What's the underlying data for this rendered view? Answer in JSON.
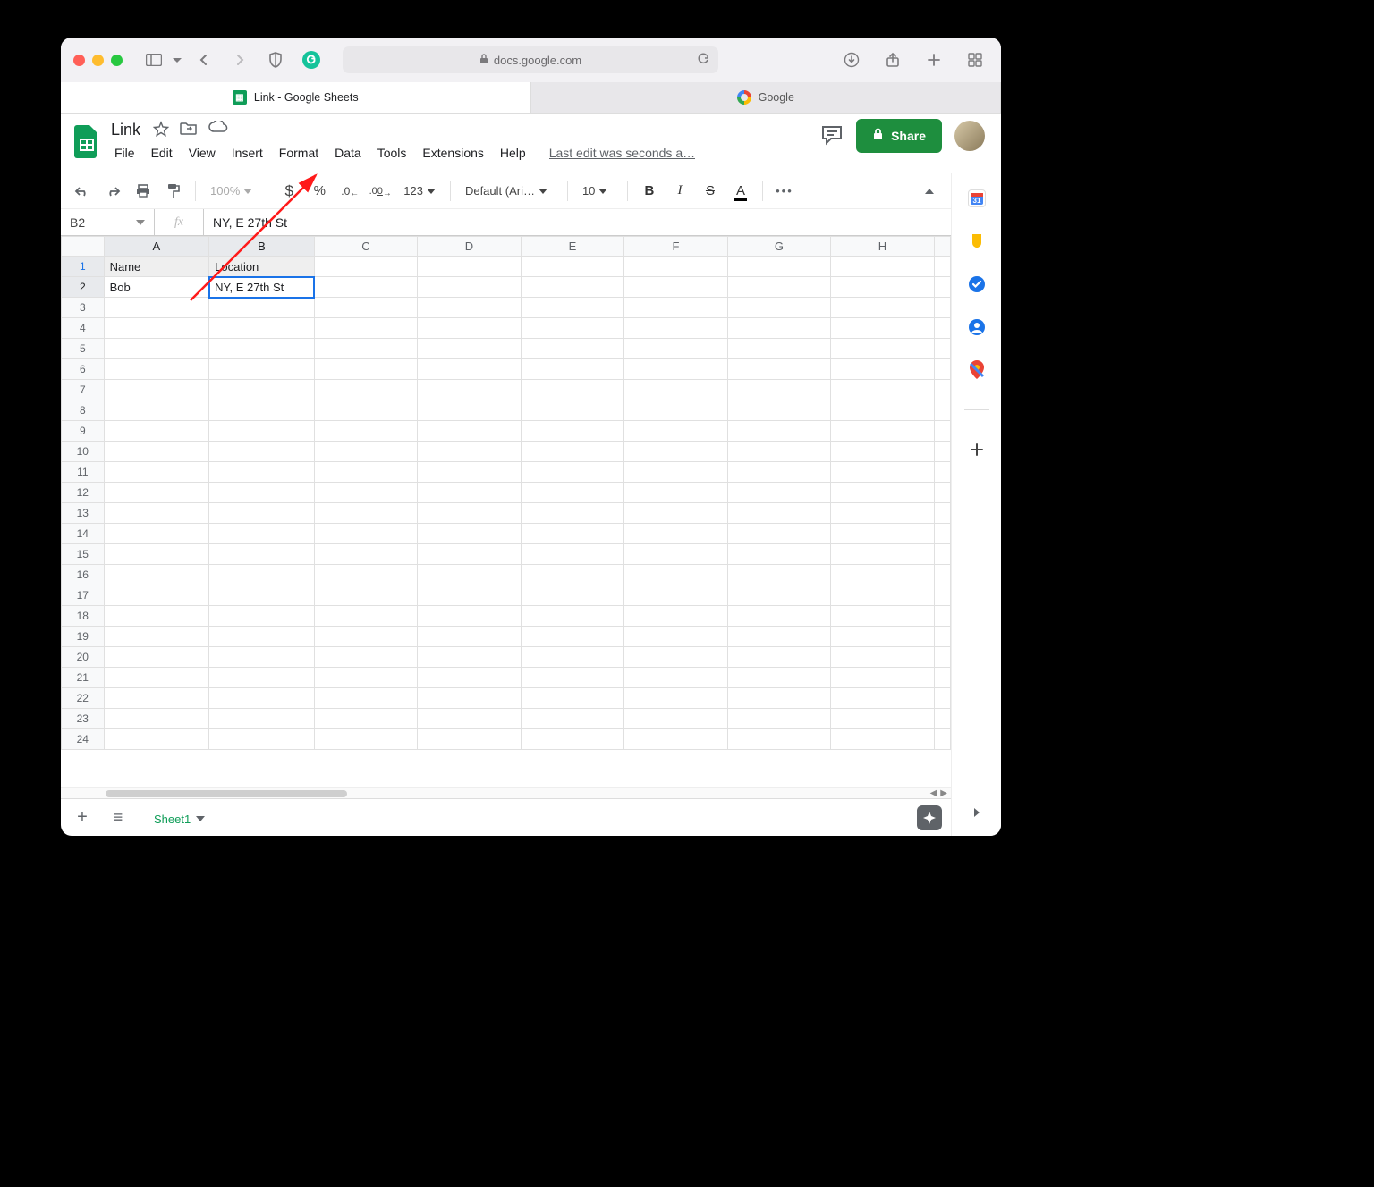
{
  "safari": {
    "address": "docs.google.com",
    "tabs": [
      {
        "label": "Link - Google Sheets",
        "active": true,
        "icon": "sheets"
      },
      {
        "label": "Google",
        "active": false,
        "icon": "google"
      }
    ]
  },
  "doc": {
    "title": "Link",
    "last_edit": "Last edit was seconds a…",
    "share_label": "Share"
  },
  "menus": [
    "File",
    "Edit",
    "View",
    "Insert",
    "Format",
    "Data",
    "Tools",
    "Extensions",
    "Help"
  ],
  "toolbar": {
    "zoom": "100%",
    "decimal_dec": ".0",
    "decimal_inc": ".00",
    "num_format": "123",
    "font": "Default (Ari…",
    "font_size": "10"
  },
  "formula_bar": {
    "cell_ref": "B2",
    "formula": "NY, E 27th St"
  },
  "grid": {
    "columns": [
      "A",
      "B",
      "C",
      "D",
      "E",
      "F",
      "G",
      "H"
    ],
    "row_count": 24,
    "selected": {
      "row": 2,
      "col": "B"
    },
    "header_highlight_cols": [
      "A",
      "B"
    ],
    "cells": {
      "A1": "Name",
      "B1": "Location",
      "A2": "Bob",
      "B2": "NY, E 27th St"
    }
  },
  "sheet_tabs": {
    "active": "Sheet1"
  },
  "side_icons": [
    "calendar",
    "keep",
    "tasks",
    "contacts",
    "maps"
  ]
}
